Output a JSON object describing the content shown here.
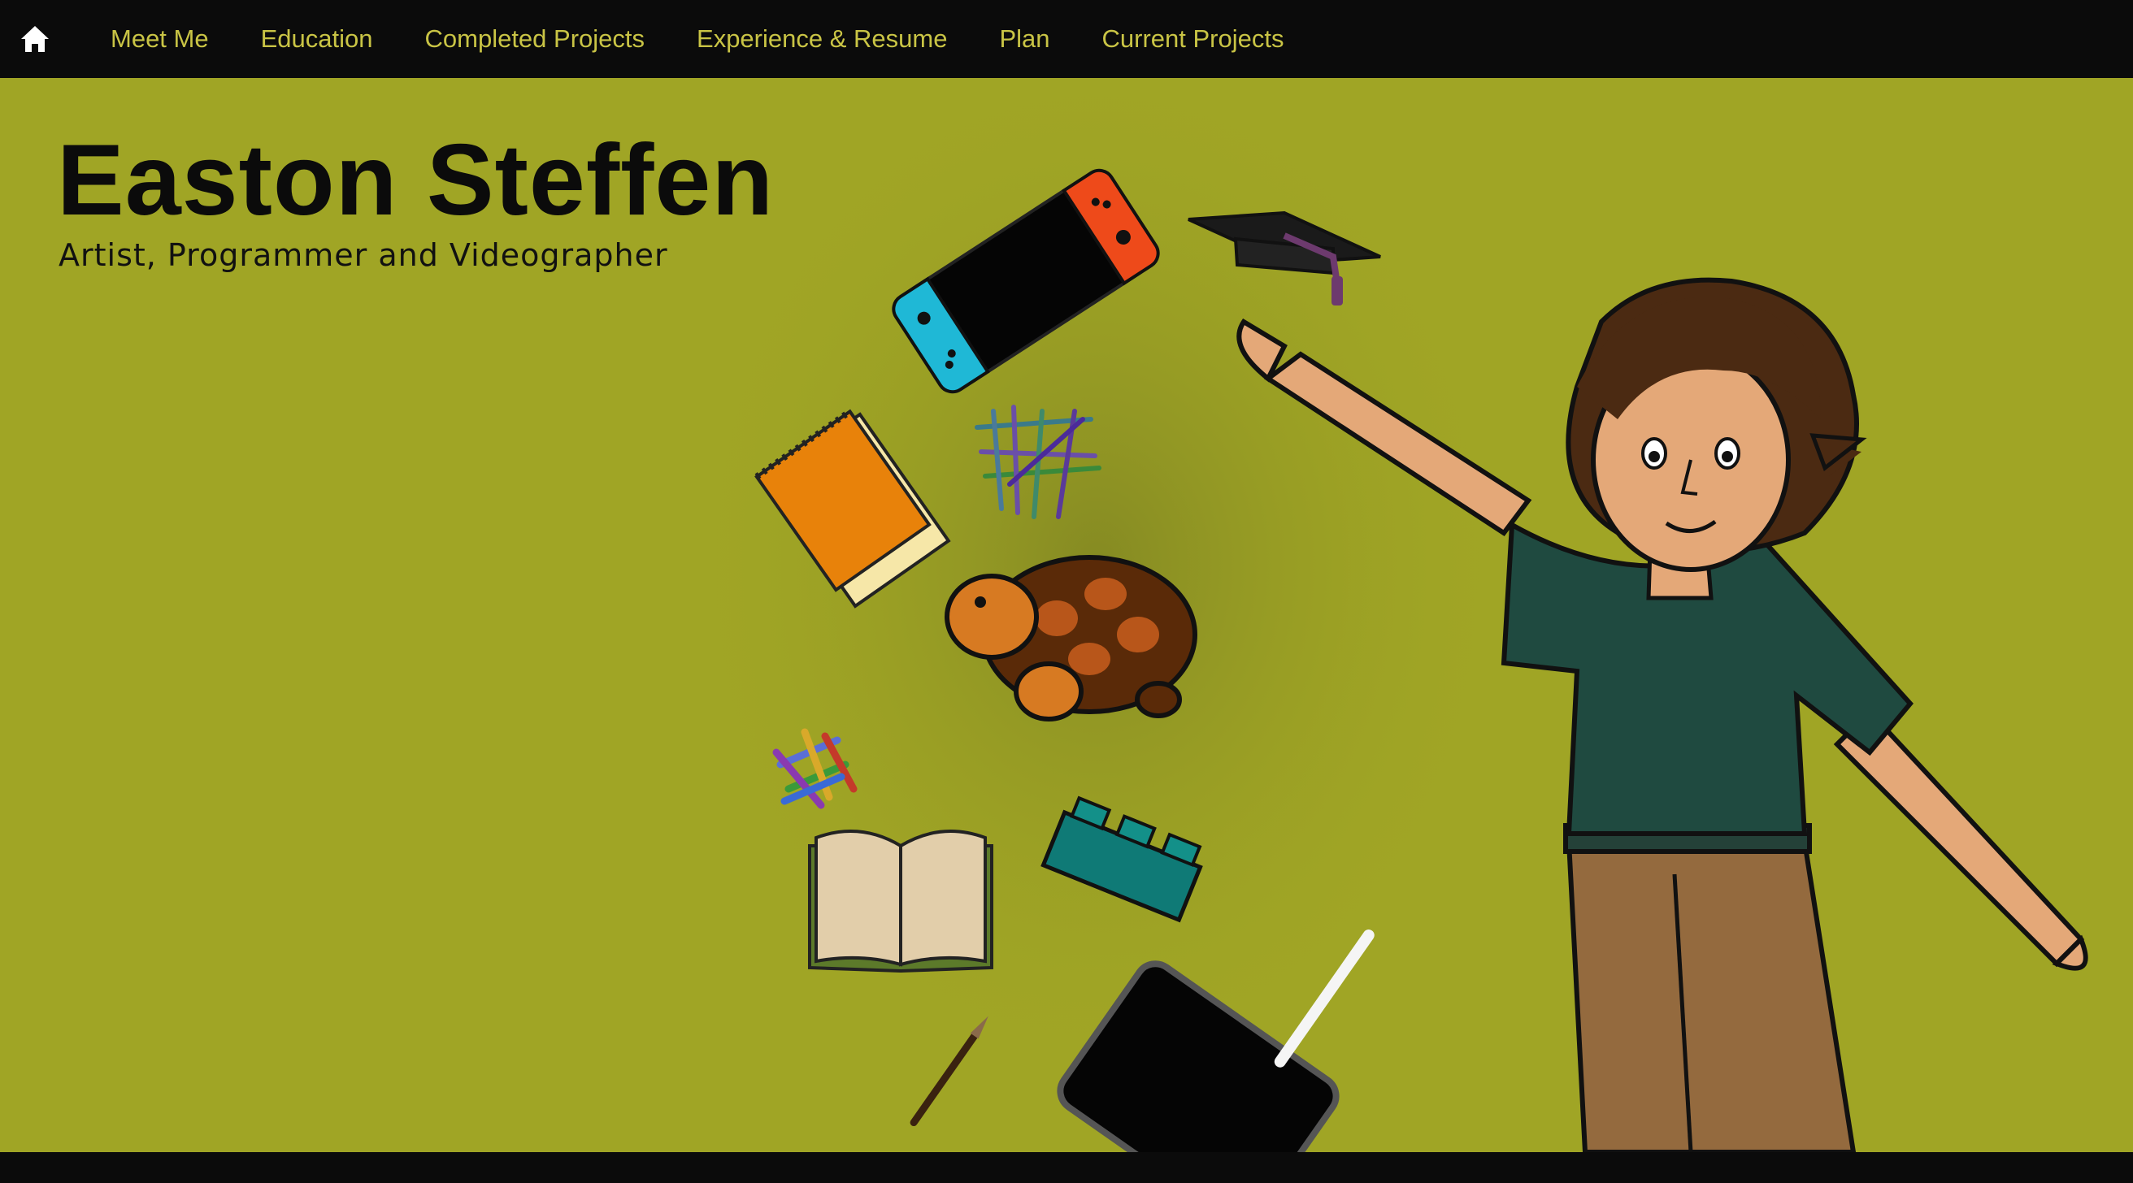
{
  "nav": {
    "home_icon": "home-icon",
    "items": [
      {
        "label": "Meet Me"
      },
      {
        "label": "Education"
      },
      {
        "label": "Completed Projects"
      },
      {
        "label": "Experience & Resume"
      },
      {
        "label": "Plan"
      },
      {
        "label": "Current Projects"
      }
    ]
  },
  "hero": {
    "title": "Easton Steffen",
    "subtitle": "Artist, Programmer and Videographer"
  },
  "colors": {
    "hero_background": "#a0a525",
    "nav_background": "#0b0b0b",
    "nav_text": "#c9c445",
    "shirt": "#1f4a40",
    "pants": "#946a3e",
    "hair": "#4b2a12",
    "skin": "#e4a878"
  },
  "illustration": {
    "icons": [
      "game-console-icon",
      "graduation-cap-icon",
      "notepad-icon",
      "colored-pencils-icon",
      "tortoise-icon",
      "crayons-icon",
      "open-book-icon",
      "lego-brick-icon",
      "paintbrush-icon",
      "drawing-tablet-icon",
      "person-avatar"
    ]
  }
}
